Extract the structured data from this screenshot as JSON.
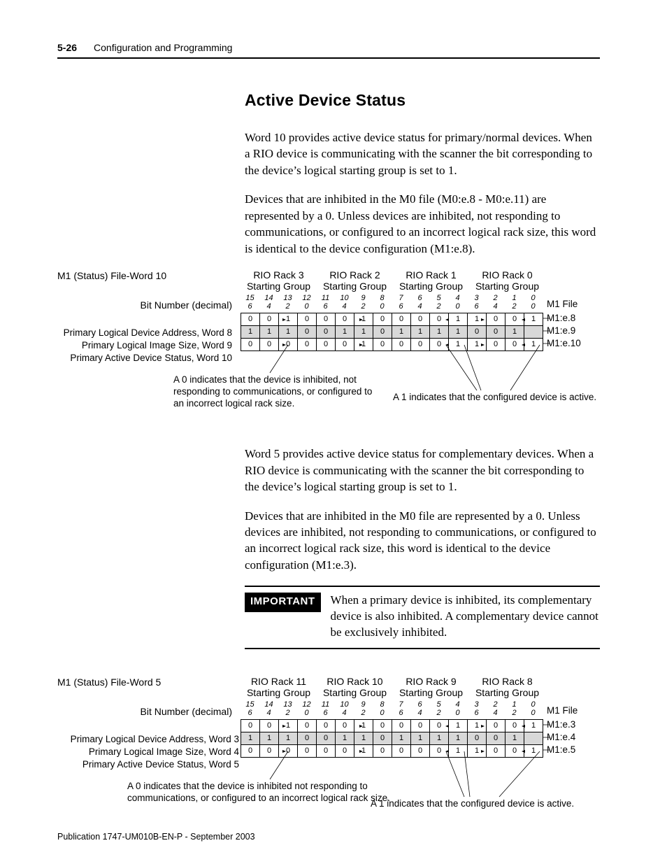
{
  "header": {
    "page_num": "5-26",
    "chapter": "Configuration and Programming"
  },
  "section_title": "Active Device Status",
  "p1": "Word 10 provides active device status for primary/normal devices. When a RIO device is communicating with the scanner the bit corresponding to the device’s logical starting group is set to 1.",
  "p2": "Devices that are inhibited in the M0 file (M0:e.8 - M0:e.11) are represented by a 0. Unless devices are inhibited, not responding to communications, or configured to an incorrect logical rack size, this word is identical to the device configuration (M1:e.8).",
  "p3": "Word 5 provides active device status for complementary devices. When a RIO device is communicating with the scanner the bit corresponding to the device’s logical starting group is set to 1.",
  "p4": "Devices that are inhibited in the M0 file are represented by a 0. Unless devices are inhibited, not responding to communications, or configured to an incorrect logical rack size, this word is identical to the device configuration (M1:e.3).",
  "important_label": "IMPORTANT",
  "important_text": "When a primary device is inhibited, its complementary device is also inhibited. A complementary device cannot be exclusively inhibited.",
  "footer": "Publication 1747-UM010B-EN-P - September 2003",
  "diag_common": {
    "bit_label": "Bit Number (decimal)",
    "bits_top": [
      "15",
      "14",
      "13",
      "12",
      "11",
      "10",
      "9",
      "8",
      "7",
      "6",
      "5",
      "4",
      "3",
      "2",
      "1",
      "0"
    ],
    "bits_bot": [
      "6",
      "4",
      "2",
      "0",
      "6",
      "4",
      "2",
      "0",
      "6",
      "4",
      "2",
      "0",
      "6",
      "4",
      "2",
      "0"
    ],
    "m1file": "M1 File",
    "annot_one": "A 1 indicates that the configured device is active."
  },
  "diag1": {
    "title": "M1 (Status) File-Word 10",
    "racks": [
      "RIO Rack 3",
      "RIO Rack 2",
      "RIO Rack 1",
      "RIO Rack 0"
    ],
    "rack_sub": "Starting Group",
    "left_rows": [
      "Primary Logical Device Address, Word 8",
      "Primary Logical Image Size, Word 9",
      "Primary Active Device Status, Word 10"
    ],
    "file_rows": [
      "M1:e.8",
      "M1:e.9",
      "M1:e.10"
    ],
    "rows": [
      [
        "0",
        "0",
        "1",
        "0",
        "0",
        "0",
        "1",
        "0",
        "0",
        "0",
        "0",
        "1",
        "1",
        "0",
        "0",
        "1"
      ],
      [
        "1",
        "1",
        "1",
        "0",
        "0",
        "1",
        "1",
        "0",
        "1",
        "1",
        "1",
        "1",
        "0",
        "0",
        "1"
      ],
      [
        "0",
        "0",
        "0",
        "0",
        "0",
        "0",
        "1",
        "0",
        "0",
        "0",
        "0",
        "1",
        "1",
        "0",
        "0",
        "1"
      ]
    ],
    "annot_zero": "A 0 indicates that the device is inhibited, not responding to communications, or configured to an incorrect logical rack size."
  },
  "diag2": {
    "title": "M1 (Status) File-Word 5",
    "racks": [
      "RIO Rack 11",
      "RIO Rack 10",
      "RIO Rack 9",
      "RIO Rack 8"
    ],
    "rack_sub": "Starting Group",
    "left_rows": [
      "Primary Logical Device Address, Word 3",
      "Primary Logical Image Size, Word 4",
      "Primary Active Device Status, Word 5"
    ],
    "file_rows": [
      "M1:e.3",
      "M1:e.4",
      "M1:e.5"
    ],
    "rows": [
      [
        "0",
        "0",
        "1",
        "0",
        "0",
        "0",
        "1",
        "0",
        "0",
        "0",
        "0",
        "1",
        "1",
        "0",
        "0",
        "1"
      ],
      [
        "1",
        "1",
        "1",
        "0",
        "0",
        "1",
        "1",
        "0",
        "1",
        "1",
        "1",
        "1",
        "0",
        "0",
        "1"
      ],
      [
        "0",
        "0",
        "0",
        "0",
        "0",
        "0",
        "1",
        "0",
        "0",
        "0",
        "0",
        "1",
        "1",
        "0",
        "0",
        "1"
      ]
    ],
    "annot_zero": "A 0 indicates that the device is inhibited not responding to communications, or configured to an incorrect logical rack size."
  }
}
